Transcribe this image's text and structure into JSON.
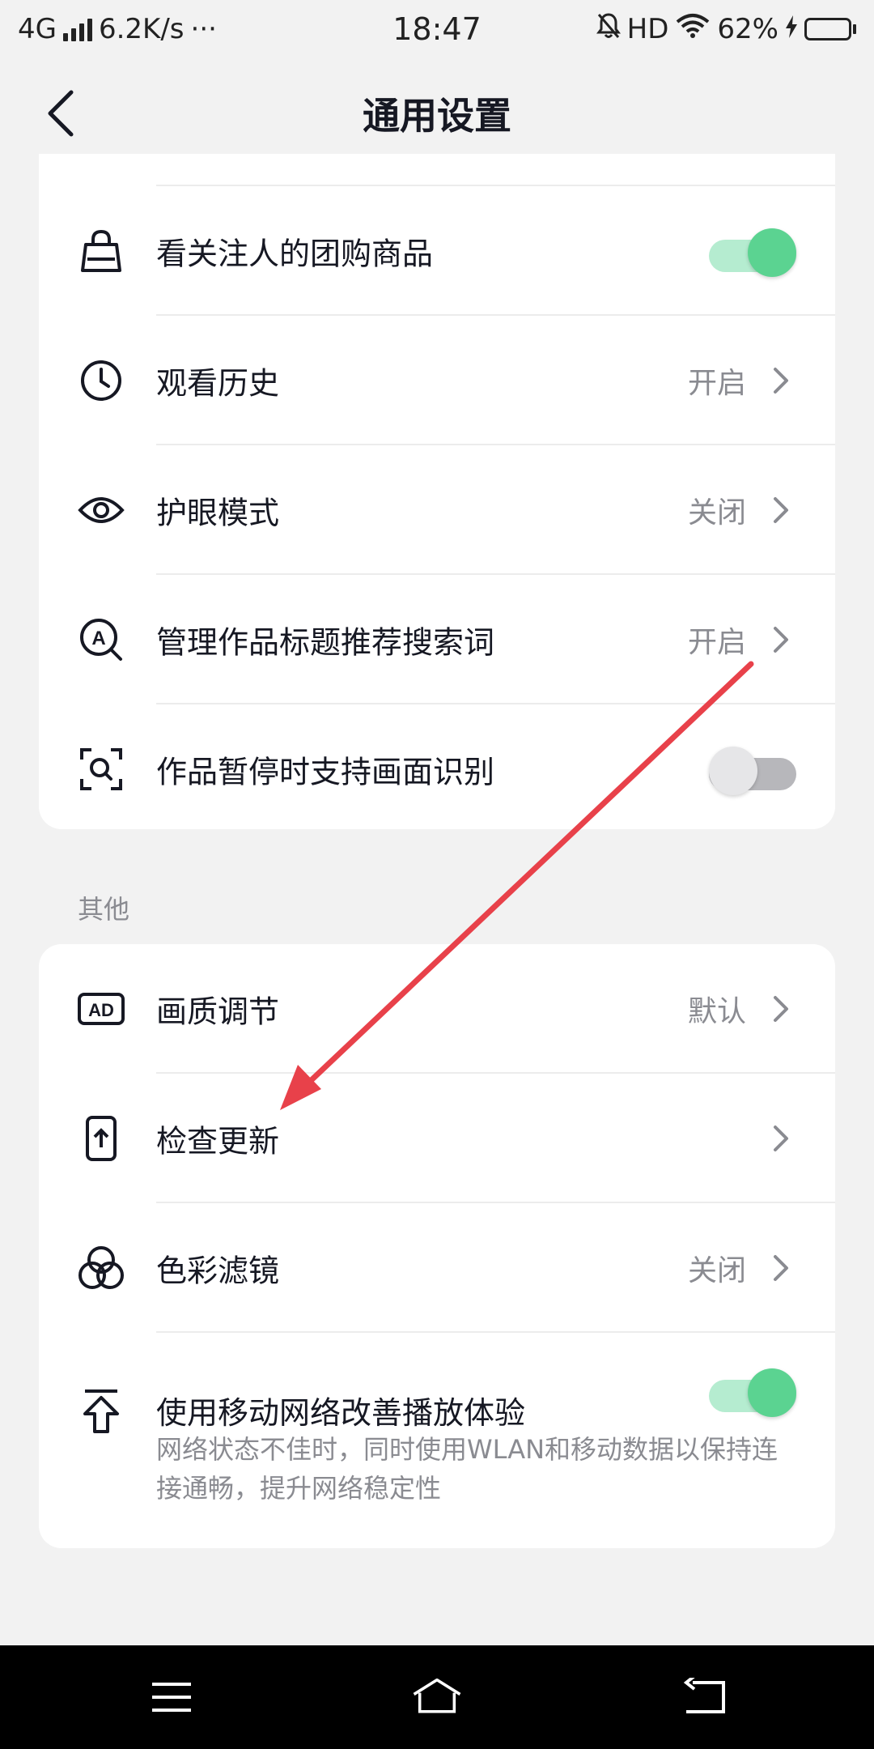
{
  "status_bar": {
    "network": "4G",
    "speed": "6.2K/s",
    "more": "···",
    "time": "18:47",
    "hd": "HD",
    "battery": "62%",
    "battery_level": 0.62
  },
  "header": {
    "title": "通用设置"
  },
  "section1": {
    "items": [
      {
        "label": "看关注人的团购商品",
        "icon": "shopping-bag-icon",
        "toggle": true
      },
      {
        "label": "观看历史",
        "icon": "clock-icon",
        "value": "开启"
      },
      {
        "label": "护眼模式",
        "icon": "eye-icon",
        "value": "关闭"
      },
      {
        "label": "管理作品标题推荐搜索词",
        "icon": "search-a-icon",
        "value": "开启"
      },
      {
        "label": "作品暂停时支持画面识别",
        "icon": "scan-icon",
        "toggle": false
      }
    ]
  },
  "section2": {
    "header": "其他",
    "items": [
      {
        "label": "画质调节",
        "icon": "ad-icon",
        "value": "默认"
      },
      {
        "label": "检查更新",
        "icon": "phone-update-icon",
        "value": ""
      },
      {
        "label": "色彩滤镜",
        "icon": "color-filter-icon",
        "value": "关闭"
      },
      {
        "label": "使用移动网络改善播放体验",
        "icon": "upload-arrow-icon",
        "toggle": true,
        "description": "网络状态不佳时，同时使用WLAN和移动数据以保持连接通畅，提升网络稳定性"
      }
    ]
  },
  "colors": {
    "toggle_on_knob": "#5bd391",
    "toggle_on_track": "#b5ecd0",
    "annotation_arrow": "#e8414a"
  }
}
